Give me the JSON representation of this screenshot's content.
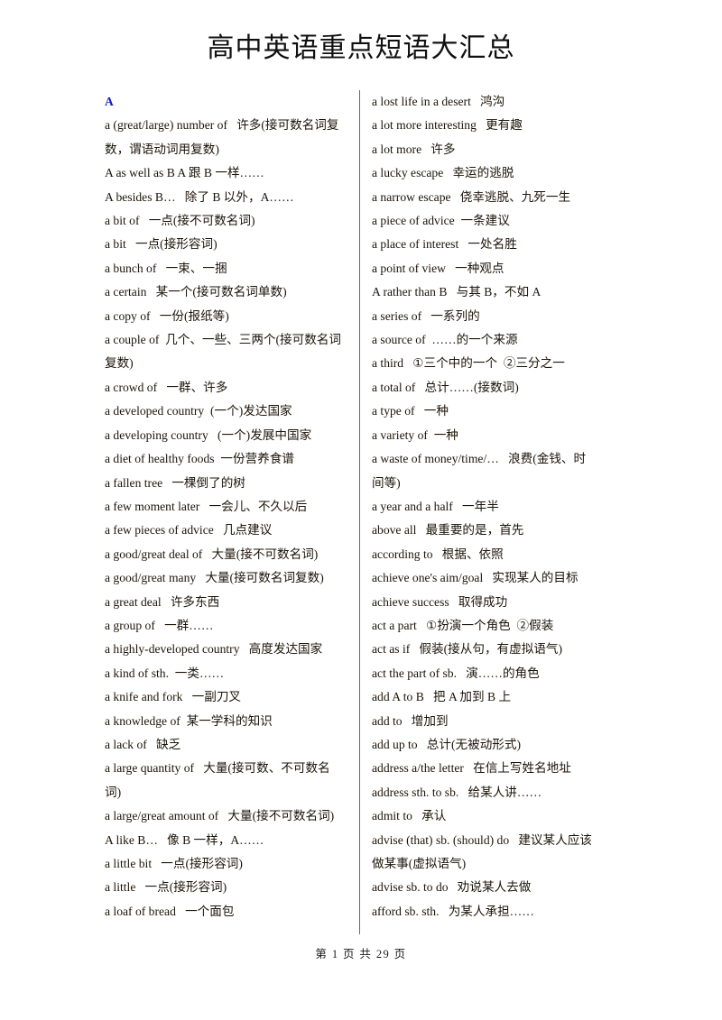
{
  "document": {
    "title": "高中英语重点短语大汇总",
    "section_letter": "A",
    "footer": "第 1 页 共 29 页",
    "accent_color": "#1015c8",
    "text_color": "#1d1409",
    "divider_color": "#6a6a6a",
    "page_background": "#ffffff"
  },
  "columns": {
    "left": [
      "a (great/large) number of   许多(接可数名词复数，谓语动词用复数)",
      "A as well as B A 跟 B 一样……",
      "A besides B…   除了 B 以外，A……",
      "a bit of   一点(接不可数名词)",
      "a bit   一点(接形容词)",
      "a bunch of   一束、一捆",
      "a certain   某一个(接可数名词单数)",
      "a copy of   一份(报纸等)",
      "a couple of  几个、一些、三两个(接可数名词复数)",
      "a crowd of   一群、许多",
      "a developed country  (一个)发达国家",
      "a developing country   (一个)发展中国家",
      "a diet of healthy foods  一份营养食谱",
      "a fallen tree   一棵倒了的树",
      "a few moment later   一会儿、不久以后",
      "a few pieces of advice   几点建议",
      "a good/great deal of   大量(接不可数名词)",
      "a good/great many   大量(接可数名词复数)",
      "a great deal   许多东西",
      "a group of   一群……",
      "a highly-developed country   高度发达国家",
      "a kind of sth.  一类……",
      "a knife and fork   一副刀叉",
      "a knowledge of  某一学科的知识",
      "a lack of   缺乏",
      "a large quantity of   大量(接可数、不可数名词)",
      "a large/great amount of   大量(接不可数名词)",
      "A like B…   像 B 一样，A……",
      "a little bit   一点(接形容词)",
      "a little   一点(接形容词)",
      "a loaf of bread   一个面包"
    ],
    "right": [
      "a lost life in a desert   鸿沟",
      "a lot more interesting   更有趣",
      "a lot more   许多",
      "a lucky escape   幸运的逃脱",
      "a narrow escape   侥幸逃脱、九死一生",
      "a piece of advice  一条建议",
      "a place of interest   一处名胜",
      "a point of view   一种观点",
      "A rather than B   与其 B，不如 A",
      "a series of   一系列的",
      "a source of  ……的一个来源",
      "a third   ①三个中的一个  ②三分之一",
      "a total of   总计……(接数词)",
      "a type of   一种",
      "a variety of  一种",
      "a waste of money/time/…   浪费(金钱、时间等)",
      "a year and a half   一年半",
      "above all   最重要的是，首先",
      "according to   根据、依照",
      "achieve one's aim/goal   实现某人的目标",
      "achieve success   取得成功",
      "act a part   ①扮演一个角色  ②假装",
      "act as if   假装(接从句，有虚拟语气)",
      "act the part of sb.   演……的角色",
      "add A to B   把 A 加到 B 上",
      "add to   增加到",
      "add up to   总计(无被动形式)",
      "address a/the letter   在信上写姓名地址",
      "address sth. to sb.   给某人讲……",
      "admit to   承认",
      "advise (that) sb. (should) do   建议某人应该做某事(虚拟语气)",
      "advise sb. to do   劝说某人去做",
      "afford sb. sth.   为某人承担……"
    ]
  }
}
